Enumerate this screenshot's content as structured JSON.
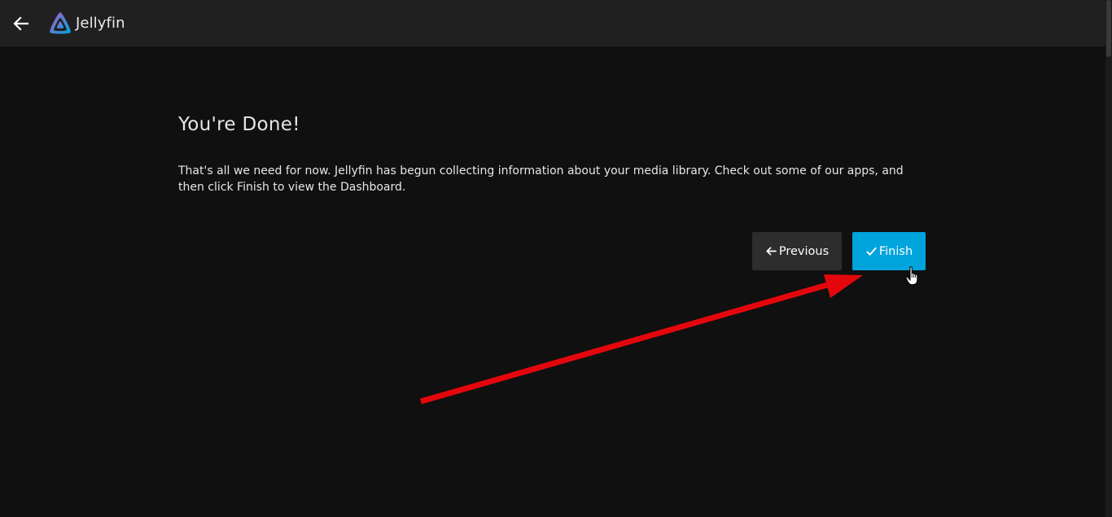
{
  "header": {
    "app_name": "Jellyfin"
  },
  "wizard": {
    "title": "You're Done!",
    "message": "That's all we need for now. Jellyfin has begun collecting information about your media library. Check out some of our apps, and then click Finish to view the Dashboard.",
    "previous_label": "Previous",
    "finish_label": "Finish"
  },
  "colors": {
    "finish_button": "#00a4dc",
    "previous_button": "#2d2d2d",
    "annotation_arrow": "#e3070d",
    "background": "#101010",
    "header": "#202020"
  },
  "icons": {
    "back": "arrow-left-icon",
    "logo": "jellyfin-logo-icon",
    "previous": "arrow-left-icon",
    "finish": "checkmark-icon",
    "cursor": "hand-pointer-icon"
  }
}
